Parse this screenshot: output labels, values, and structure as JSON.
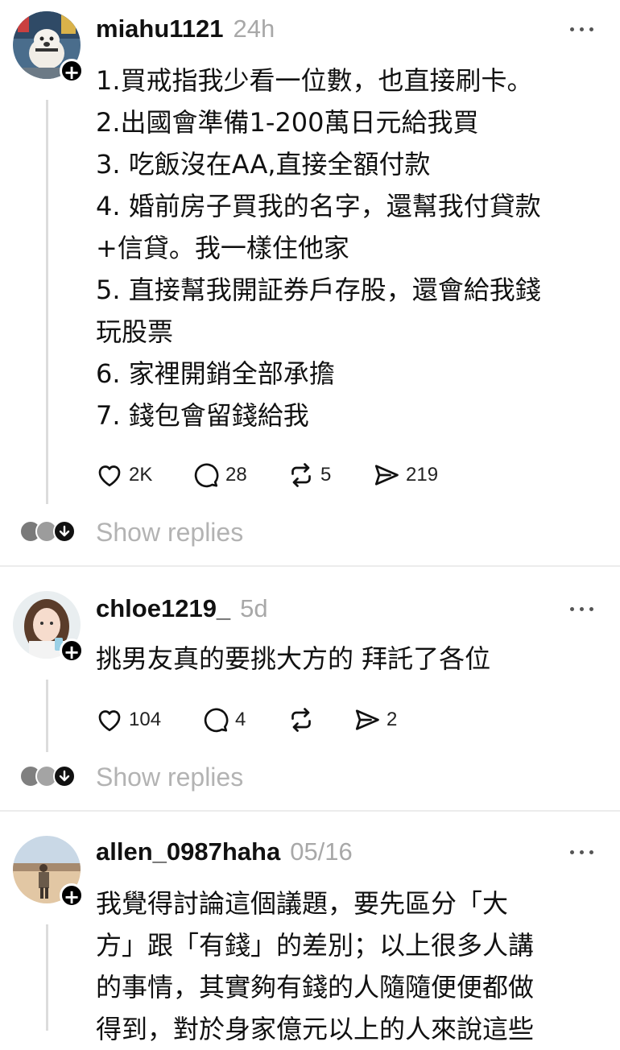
{
  "posts": [
    {
      "username": "miahu1121",
      "time": "24h",
      "lines": [
        "1.買戒指我少看一位數，也直接刷卡。",
        "2.出國會準備1-200萬日元給我買",
        "3. 吃飯沒在AA,直接全額付款",
        "4. 婚前房子買我的名字，還幫我付貸款",
        "+信貸。我一樣住他家",
        "5. 直接幫我開証券戶存股，還會給我錢",
        "玩股票",
        "6. 家裡開銷全部承擔",
        "7. 錢包會留錢給我"
      ],
      "likes": "2K",
      "comments": "28",
      "reposts": "5",
      "shares": "219",
      "show_replies": "Show replies",
      "avatar_icon": "bulldog-avatar"
    },
    {
      "username": "chloe1219_",
      "time": "5d",
      "lines": [
        "挑男友真的要挑大方的 拜託了各位"
      ],
      "likes": "104",
      "comments": "4",
      "reposts": "",
      "shares": "2",
      "show_replies": "Show replies",
      "avatar_icon": "girl-avatar"
    },
    {
      "username": "allen_0987haha",
      "time": "05/16",
      "lines": [
        "我覺得討論這個議題，要先區分「大",
        "方」跟「有錢」的差別；以上很多人講",
        "的事情，其實夠有錢的人隨隨便便都做",
        "得到，對於身家億元以上的人來說這些"
      ],
      "avatar_icon": "desert-avatar"
    }
  ],
  "icons": {
    "like": "heart-icon",
    "comment": "comment-icon",
    "repost": "repost-icon",
    "share": "send-icon",
    "more": "more-icon",
    "follow": "plus-icon",
    "expand": "arrow-down-icon"
  },
  "colors": {
    "text": "#111111",
    "muted": "#a8a8a8",
    "divider": "#ececec"
  }
}
